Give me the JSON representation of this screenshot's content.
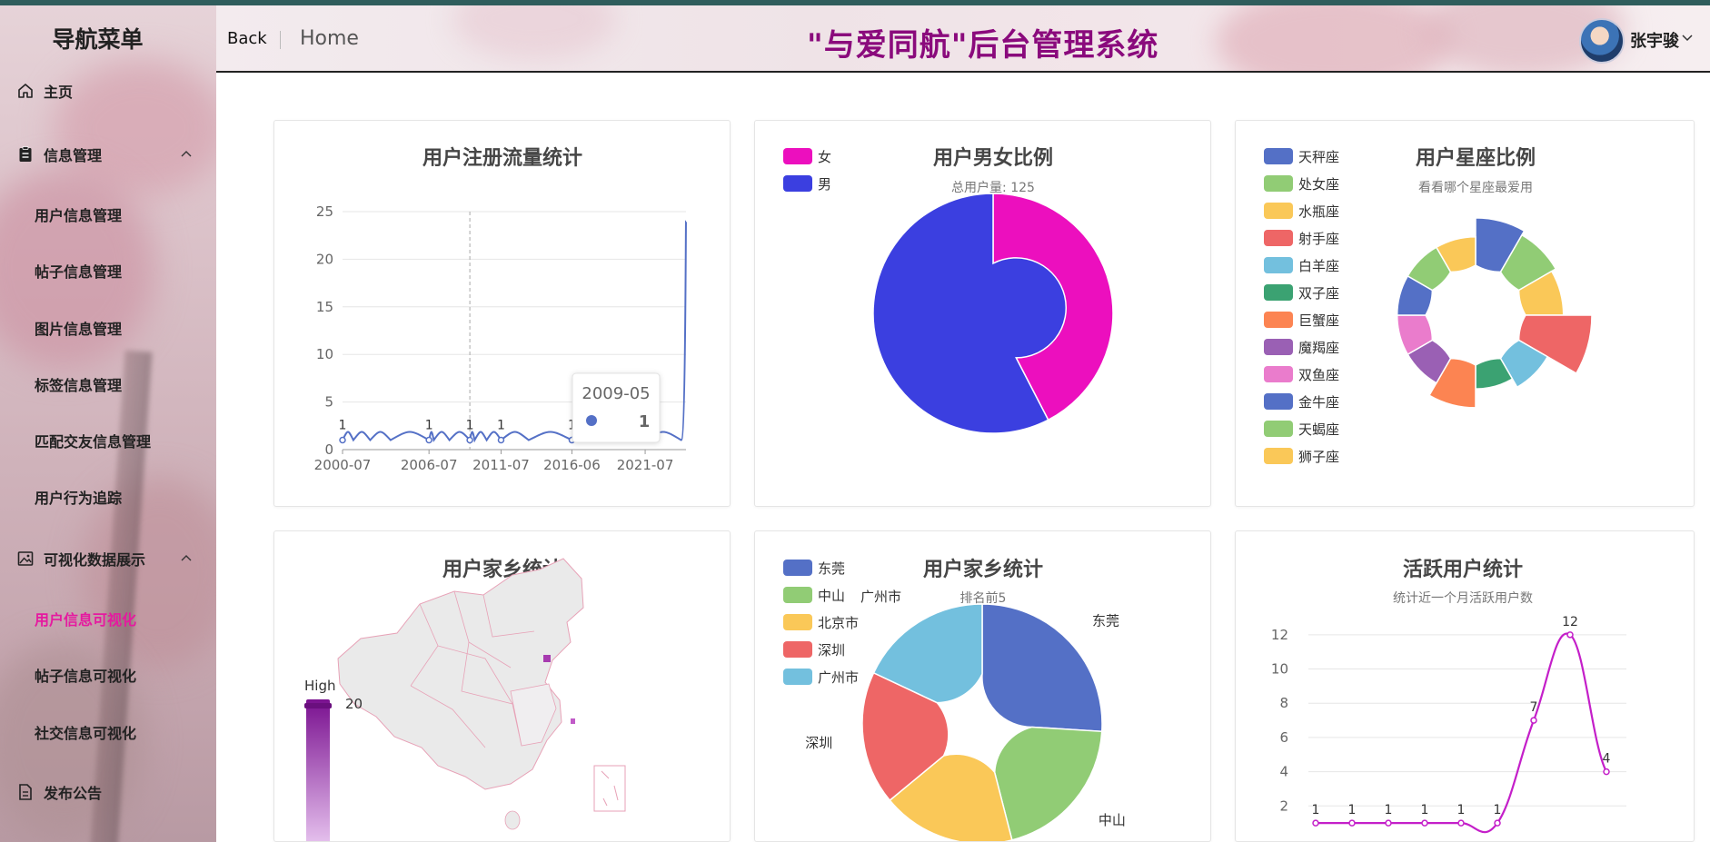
{
  "sidebar": {
    "title": "导航菜单",
    "home": "主页",
    "info_group": "信息管理",
    "info_items": [
      "用户信息管理",
      "帖子信息管理",
      "图片信息管理",
      "标签信息管理",
      "匹配交友信息管理",
      "用户行为追踪"
    ],
    "viz_group": "可视化数据展示",
    "viz_items": [
      "用户信息可视化",
      "帖子信息可视化",
      "社交信息可视化"
    ],
    "announce": "发布公告"
  },
  "header": {
    "back": "Back",
    "home": "Home",
    "title": "\"与爱同航\"后台管理系统",
    "user": "张宇骏"
  },
  "colors": {
    "accent_active": "#e51aa0",
    "title": "#8a0a7c",
    "female": "#ec0fbe",
    "male": "#3b3fe0",
    "line_blue": "#5470c6",
    "active_line": "#c41fc9"
  },
  "chart_data": [
    {
      "type": "line",
      "title": "用户注册流量统计",
      "x_ticks": [
        "2000-07",
        "2006-07",
        "2011-07",
        "2016-06",
        "2021-07"
      ],
      "yticks": [
        0,
        5,
        10,
        15,
        20,
        25
      ],
      "ylim": [
        0,
        25
      ],
      "x": [
        "2000-07",
        "2001-04",
        "2002-06",
        "2003-11",
        "2006-07",
        "2006-11",
        "2007-12",
        "2009-05",
        "2009-09",
        "2010-07",
        "2011-07",
        "2013-06",
        "2016-06",
        "2016-10",
        "2018-09",
        "2021-07",
        "2024-01",
        "2024-05"
      ],
      "values": [
        1,
        1,
        1,
        1,
        1,
        1,
        1,
        1,
        1,
        1,
        1,
        1,
        1,
        1,
        1,
        1,
        1,
        24
      ],
      "labeled_points": [
        {
          "x": "2000-07",
          "label": "1"
        },
        {
          "x": "2006-07",
          "label": "1"
        },
        {
          "x": "2009-05",
          "label": "1"
        },
        {
          "x": "2011-07",
          "label": "1"
        },
        {
          "x": "2016-06",
          "label": "1"
        }
      ],
      "tooltip": {
        "title": "2009-05",
        "value": "1"
      }
    },
    {
      "type": "pie",
      "title": "用户男女比例",
      "subtitle": "总用户量: 125",
      "categories": [
        "女",
        "男"
      ],
      "values": [
        53,
        72
      ],
      "legend_position": "top-left"
    },
    {
      "type": "pie",
      "variant": "rose",
      "title": "用户星座比例",
      "subtitle": "看看哪个星座最爱用",
      "categories": [
        "天秤座",
        "处女座",
        "水瓶座",
        "射手座",
        "白羊座",
        "双子座",
        "巨蟹座",
        "魔羯座",
        "双鱼座",
        "金牛座",
        "天蝎座",
        "狮子座"
      ],
      "values": [
        10,
        9,
        8,
        14,
        7,
        5,
        9,
        6,
        6,
        6,
        6,
        6
      ],
      "colors": [
        "#5470c6",
        "#91cc75",
        "#fac858",
        "#ee6666",
        "#73c0de",
        "#3ba272",
        "#fc8452",
        "#9a60b4",
        "#ea7ccc",
        "#5470c6",
        "#91cc75",
        "#fac858"
      ],
      "legend_position": "left"
    },
    {
      "type": "map",
      "title": "用户家乡统计",
      "visual_map": {
        "high_label": "High",
        "max": 20
      }
    },
    {
      "type": "pie",
      "title": "用户家乡统计",
      "subtitle": "排名前5",
      "categories": [
        "东莞",
        "中山",
        "北京市",
        "深圳",
        "广州市"
      ],
      "values": [
        26,
        20,
        18,
        18,
        18
      ],
      "colors": [
        "#5470c6",
        "#91cc75",
        "#fac858",
        "#ee6666",
        "#73c0de"
      ],
      "visible_labels": [
        "东莞",
        "中山",
        "深圳",
        "广州市"
      ],
      "legend_position": "top-left"
    },
    {
      "type": "line",
      "title": "活跃用户统计",
      "subtitle": "统计近一个月活跃用户数",
      "values": [
        1,
        1,
        1,
        1,
        1,
        1,
        7,
        12,
        4
      ],
      "yticks": [
        2,
        4,
        6,
        8,
        10,
        12
      ],
      "ylim": [
        0,
        13
      ]
    }
  ]
}
